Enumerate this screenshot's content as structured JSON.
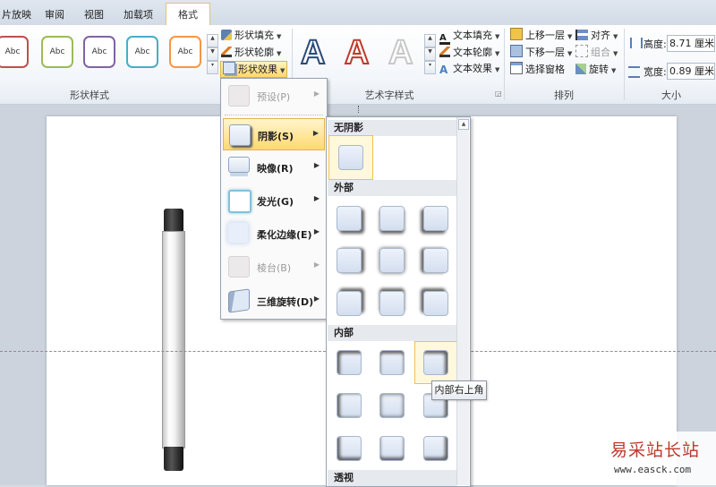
{
  "tabs": [
    "片放映",
    "审阅",
    "视图",
    "加载项",
    "格式"
  ],
  "shape_styles": {
    "swatch_label": "Abc",
    "swatch_colors": [
      "#c0504d",
      "#9bbb59",
      "#8064a2",
      "#4bacc6",
      "#f79646"
    ],
    "group_label": "形状样式"
  },
  "shape_buttons": {
    "fill": "形状填充",
    "outline": "形状轮廓",
    "effects": "形状效果"
  },
  "wordart": {
    "letter": "A",
    "group_label": "艺术字样式",
    "text_fill": "文本填充",
    "text_outline": "文本轮廓",
    "text_effects": "文本效果"
  },
  "arrange": {
    "group_label": "排列",
    "bring_forward": "上移一层",
    "send_backward": "下移一层",
    "selection_pane": "选择窗格",
    "align": "对齐",
    "group": "组合",
    "rotate": "旋转"
  },
  "size": {
    "group_label": "大小",
    "height_label": "高度:",
    "height_value": "8.71 厘米",
    "width_label": "宽度:",
    "width_value": "0.89 厘米"
  },
  "effects_menu": [
    {
      "label": "预设(P)",
      "enabled": false
    },
    {
      "label": "阴影(S)",
      "enabled": true,
      "highlighted": true
    },
    {
      "label": "映像(R)",
      "enabled": true
    },
    {
      "label": "发光(G)",
      "enabled": true
    },
    {
      "label": "柔化边缘(E)",
      "enabled": true
    },
    {
      "label": "棱台(B)",
      "enabled": false
    },
    {
      "label": "三维旋转(D)",
      "enabled": true
    }
  ],
  "shadow_gallery": {
    "no_shadow": "无阴影",
    "outer": "外部",
    "inner": "内部",
    "perspective": "透视"
  },
  "tooltip": "内部右上角",
  "watermark": {
    "name": "易采站长站",
    "url": "www.easck.com"
  }
}
